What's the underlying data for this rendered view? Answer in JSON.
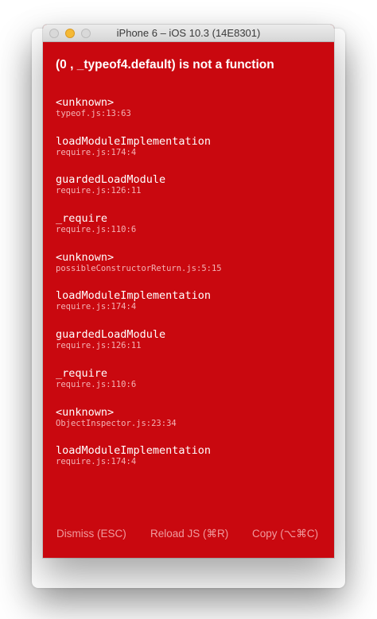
{
  "window": {
    "title": "iPhone 6 – iOS 10.3 (14E8301)"
  },
  "error": {
    "message": "(0 , _typeof4.default) is not a function"
  },
  "stack": [
    {
      "name": "<unknown>",
      "location": "typeof.js:13:63"
    },
    {
      "name": "loadModuleImplementation",
      "location": "require.js:174:4"
    },
    {
      "name": "guardedLoadModule",
      "location": "require.js:126:11"
    },
    {
      "name": "_require",
      "location": "require.js:110:6"
    },
    {
      "name": "<unknown>",
      "location": "possibleConstructorReturn.js:5:15"
    },
    {
      "name": "loadModuleImplementation",
      "location": "require.js:174:4"
    },
    {
      "name": "guardedLoadModule",
      "location": "require.js:126:11"
    },
    {
      "name": "_require",
      "location": "require.js:110:6"
    },
    {
      "name": "<unknown>",
      "location": "ObjectInspector.js:23:34"
    },
    {
      "name": "loadModuleImplementation",
      "location": "require.js:174:4"
    }
  ],
  "footer": {
    "dismiss_label": "Dismiss (ESC)",
    "reload_label": "Reload JS (⌘R)",
    "copy_label": "Copy (⌥⌘C)"
  },
  "colors": {
    "background": "#c9080f",
    "text": "#ffffff",
    "location_text": "#f3b3b5",
    "footer_text": "#f09a9d"
  }
}
